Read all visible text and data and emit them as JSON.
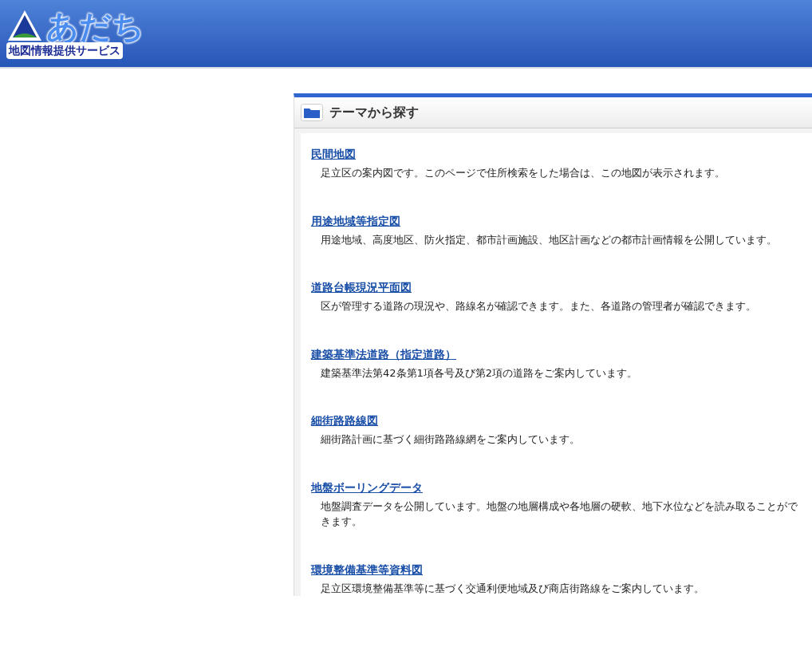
{
  "header": {
    "logo_title": "あだち",
    "logo_subtitle": "地図情報提供サービス"
  },
  "panel": {
    "title": "テーマから探す",
    "items": [
      {
        "title": "民間地図",
        "description": "足立区の案内図です。このページで住所検索をした場合は、この地図が表示されます。"
      },
      {
        "title": "用途地域等指定図",
        "description": "用途地域、高度地区、防火指定、都市計画施設、地区計画などの都市計画情報を公開しています。"
      },
      {
        "title": "道路台帳現況平面図",
        "description": "区が管理する道路の現況や、路線名が確認できます。また、各道路の管理者が確認できます。"
      },
      {
        "title": "建築基準法道路（指定道路）",
        "description": "建築基準法第42条第1項各号及び第2項の道路をご案内しています。"
      },
      {
        "title": "細街路路線図",
        "description": "細街路計画に基づく細街路路線網をご案内しています。"
      },
      {
        "title": "地盤ボーリングデータ",
        "description": "地盤調査データを公開しています。地盤の地層構成や各地層の硬軟、地下水位などを読み取ることができます。"
      },
      {
        "title": "環境整備基準等資料図",
        "description": "足立区環境整備基準等に基づく交通利便地域及び商店街路線をご案内しています。"
      }
    ]
  }
}
